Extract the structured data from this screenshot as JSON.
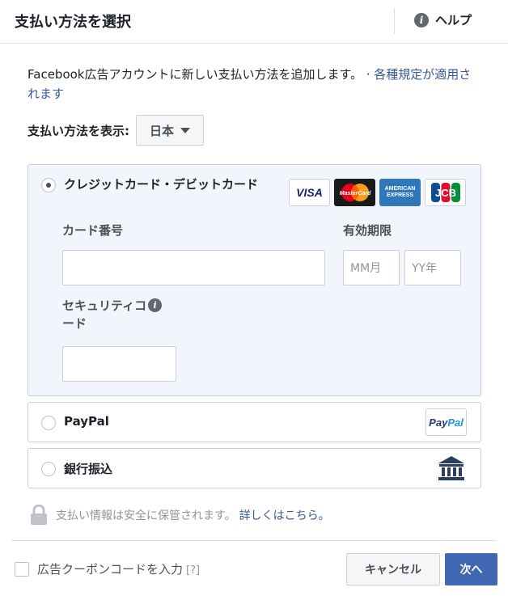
{
  "header": {
    "title": "支払い方法を選択",
    "help_icon": "i",
    "help_label": "ヘルプ"
  },
  "description": {
    "text": "Facebook広告アカウントに新しい支払い方法を追加します。 · ",
    "link": "各種規定が適用されます"
  },
  "display": {
    "label": "支払い方法を表示:",
    "selected_country": "日本"
  },
  "payment_methods": {
    "card": {
      "label": "クレジットカード・デビットカード",
      "selected": true,
      "logos": [
        "VISA",
        "MasterCard",
        "AMERICAN EXPRESS",
        "JCB"
      ],
      "card_number_label": "カード番号",
      "card_number_value": "",
      "expiry_label": "有効期限",
      "month_placeholder": "MM月",
      "year_placeholder": "YY年",
      "security_label_line1": "セキュリティコ",
      "security_label_line2": "ード",
      "security_value": ""
    },
    "paypal": {
      "label": "PayPal",
      "logo_pay": "Pay",
      "logo_pal": "Pal"
    },
    "bank": {
      "label": "銀行振込"
    }
  },
  "secure_note": {
    "text": "支払い情報は安全に保管されます。",
    "link": "詳しくはこちら。"
  },
  "footer": {
    "coupon_label": "広告クーポンコードを入力",
    "coupon_hint": "[?]",
    "cancel_label": "キャンセル",
    "next_label": "次へ"
  },
  "colors": {
    "link": "#365899",
    "primary_button": "#4267b2",
    "card_panel_bg": "#f2f6fc",
    "card_panel_border": "#bfcde3"
  }
}
